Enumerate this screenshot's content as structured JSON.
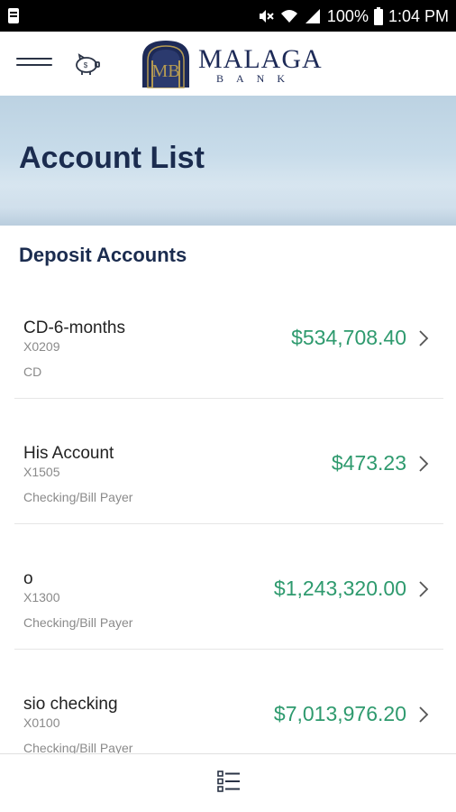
{
  "status_bar": {
    "battery": "100%",
    "time": "1:04 PM",
    "icons": [
      "notification-icon",
      "mute-icon",
      "wifi-icon",
      "signal-icon",
      "battery-icon"
    ]
  },
  "app_bar": {
    "menu_icon": "hamburger-menu-icon",
    "savings_icon": "piggy-bank-icon",
    "logo_monogram": "MB",
    "logo_name": "MALAGA",
    "logo_sub": "BANK",
    "colors": {
      "brand": "#1d2a57",
      "gold": "#b49a52"
    }
  },
  "hero": {
    "title": "Account List"
  },
  "section": {
    "title": "Deposit Accounts"
  },
  "accounts": [
    {
      "name": "CD-6-months",
      "number": "X0209",
      "type": "CD",
      "balance": "$534,708.40"
    },
    {
      "name": "His Account",
      "number": "X1505",
      "type": "Checking/Bill Payer",
      "balance": "$473.23"
    },
    {
      "name": "o",
      "number": "X1300",
      "type": "Checking/Bill Payer",
      "balance": "$1,243,320.00"
    },
    {
      "name": "sio checking",
      "number": "X0100",
      "type": "Checking/Bill Payer",
      "balance": "$7,013,976.20"
    }
  ],
  "bottom_bar": {
    "icon": "account-list-icon"
  },
  "colors": {
    "balance": "#2e9a6e",
    "heading": "#1b2c4f"
  }
}
